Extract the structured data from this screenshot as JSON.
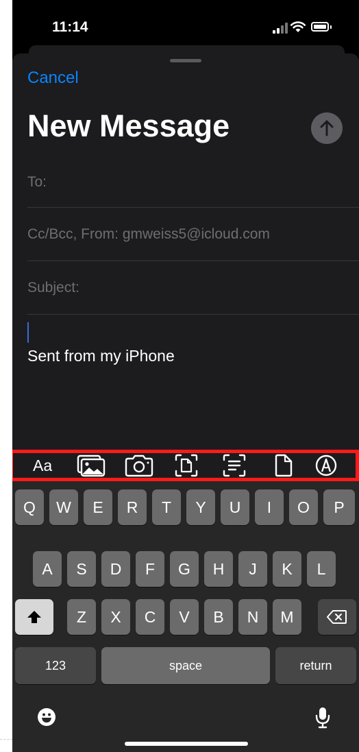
{
  "status_bar": {
    "time": "11:14"
  },
  "compose": {
    "cancel_label": "Cancel",
    "title": "New Message",
    "to_label": "To:",
    "cc_from_label": "Cc/Bcc, From: gmweiss5@icloud.com",
    "subject_label": "Subject:",
    "signature": "Sent from my iPhone",
    "accent_color": "#0a84ff"
  },
  "toolbar": {
    "highlight_color": "#ff1a1a",
    "items": [
      {
        "label": "Aa",
        "icon": "text-format-icon"
      },
      {
        "icon": "photo-library-icon"
      },
      {
        "icon": "camera-icon"
      },
      {
        "icon": "scan-document-icon"
      },
      {
        "icon": "scan-text-icon"
      },
      {
        "icon": "attach-file-icon"
      },
      {
        "icon": "markup-icon"
      }
    ]
  },
  "keyboard": {
    "row1": [
      "Q",
      "W",
      "E",
      "R",
      "T",
      "Y",
      "U",
      "I",
      "O",
      "P"
    ],
    "row2": [
      "A",
      "S",
      "D",
      "F",
      "G",
      "H",
      "J",
      "K",
      "L"
    ],
    "row3": [
      "Z",
      "X",
      "C",
      "V",
      "B",
      "N",
      "M"
    ],
    "numbers_label": "123",
    "space_label": "space",
    "return_label": "return"
  }
}
